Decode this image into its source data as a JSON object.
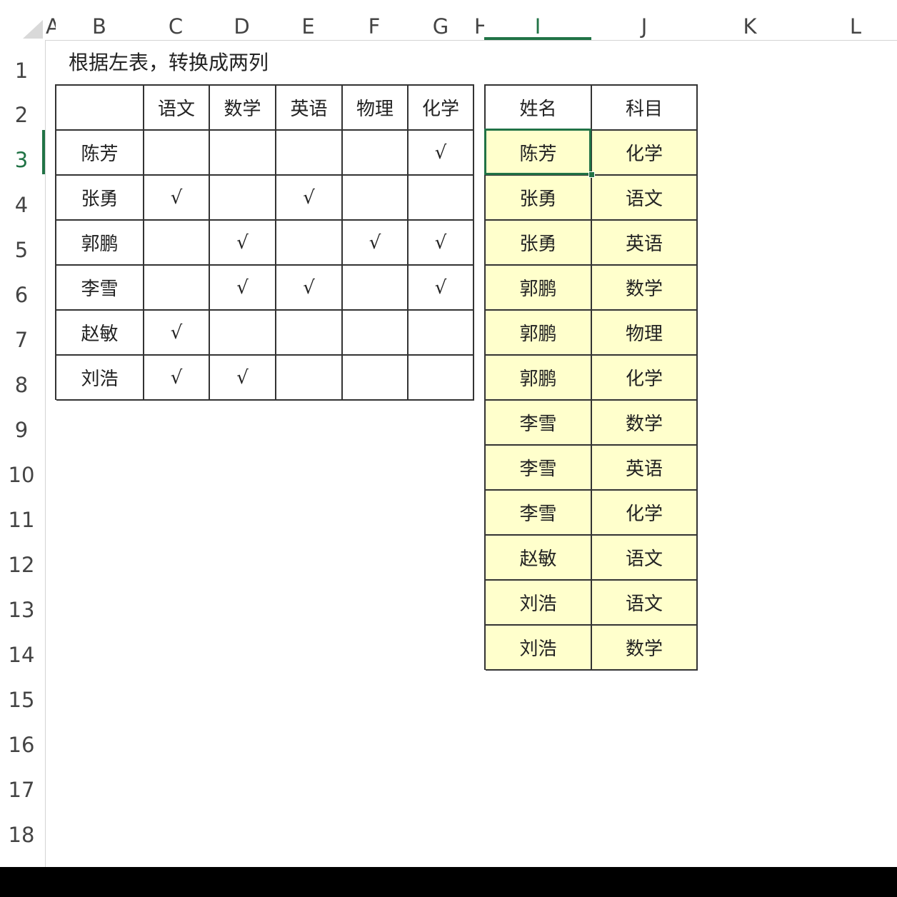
{
  "columns": [
    "A",
    "B",
    "C",
    "D",
    "E",
    "F",
    "G",
    "H",
    "I",
    "J",
    "K",
    "L"
  ],
  "rows": [
    "1",
    "2",
    "3",
    "4",
    "5",
    "6",
    "7",
    "8",
    "9",
    "10",
    "11",
    "12",
    "13",
    "14",
    "15",
    "16",
    "17",
    "18"
  ],
  "selected": {
    "column": "I",
    "row": "3"
  },
  "title": "根据左表，转换成两列",
  "left_table": {
    "headers": [
      "",
      "语文",
      "数学",
      "英语",
      "物理",
      "化学"
    ],
    "rows": [
      {
        "name": "陈芳",
        "marks": [
          "",
          "",
          "",
          "",
          "√"
        ]
      },
      {
        "name": "张勇",
        "marks": [
          "√",
          "",
          "√",
          "",
          ""
        ]
      },
      {
        "name": "郭鹏",
        "marks": [
          "",
          "√",
          "",
          "√",
          "√"
        ]
      },
      {
        "name": "李雪",
        "marks": [
          "",
          "√",
          "√",
          "",
          "√"
        ]
      },
      {
        "name": "赵敏",
        "marks": [
          "√",
          "",
          "",
          "",
          ""
        ]
      },
      {
        "name": "刘浩",
        "marks": [
          "√",
          "√",
          "",
          "",
          ""
        ]
      }
    ]
  },
  "right_table": {
    "headers": [
      "姓名",
      "科目"
    ],
    "rows": [
      [
        "陈芳",
        "化学"
      ],
      [
        "张勇",
        "语文"
      ],
      [
        "张勇",
        "英语"
      ],
      [
        "郭鹏",
        "数学"
      ],
      [
        "郭鹏",
        "物理"
      ],
      [
        "郭鹏",
        "化学"
      ],
      [
        "李雪",
        "数学"
      ],
      [
        "李雪",
        "英语"
      ],
      [
        "李雪",
        "化学"
      ],
      [
        "赵敏",
        "语文"
      ],
      [
        "刘浩",
        "语文"
      ],
      [
        "刘浩",
        "数学"
      ]
    ]
  },
  "colors": {
    "accent": "#217346",
    "highlight": "#ffffcc"
  }
}
